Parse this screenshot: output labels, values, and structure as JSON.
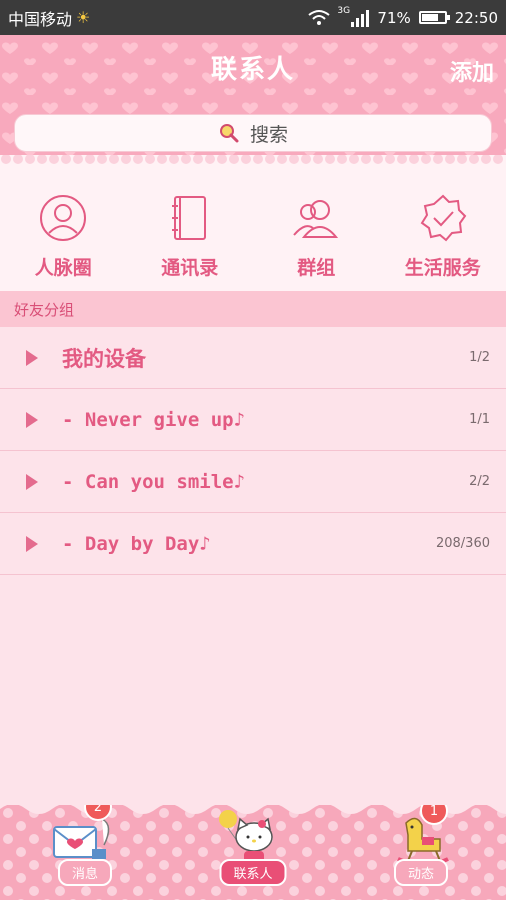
{
  "status_bar": {
    "carrier": "中国移动",
    "network": "3G",
    "battery": "71%",
    "battery_level": 0.71,
    "time": "22:50"
  },
  "header": {
    "title": "联系人",
    "add_label": "添加"
  },
  "search": {
    "label": "搜索"
  },
  "quicknav": [
    {
      "label": "人脉圈",
      "icon": "person-circle-icon"
    },
    {
      "label": "通讯录",
      "icon": "address-book-icon"
    },
    {
      "label": "群组",
      "icon": "group-icon"
    },
    {
      "label": "生活服务",
      "icon": "badge-check-icon"
    }
  ],
  "section": {
    "title": "好友分组"
  },
  "groups": [
    {
      "name": "我的设备",
      "count": "1/2"
    },
    {
      "name": "- Never give up♪",
      "count": "1/1"
    },
    {
      "name": "- Can you smile♪",
      "count": "2/2"
    },
    {
      "name": "- Day by Day♪",
      "count": "208/360"
    }
  ],
  "bottom_nav": [
    {
      "label": "消息",
      "badge": "2"
    },
    {
      "label": "联系人",
      "badge": ""
    },
    {
      "label": "动态",
      "badge": "1"
    }
  ],
  "colors": {
    "accent": "#e35a82",
    "header_pink": "#f8a9bd",
    "background": "#fde3ea"
  }
}
